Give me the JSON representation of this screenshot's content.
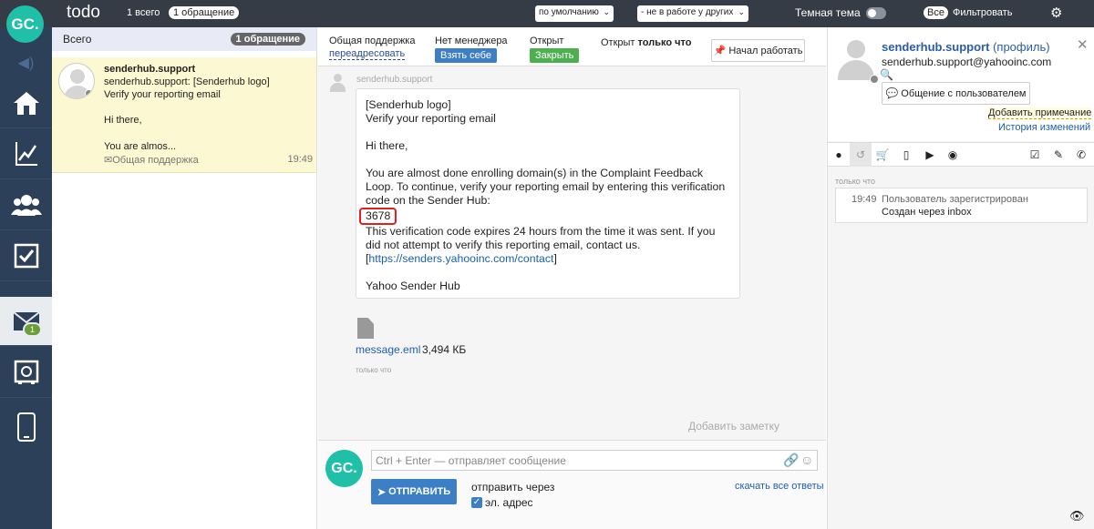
{
  "topbar": {
    "logo": "GC.",
    "title": "todo",
    "count_all": "1 всего",
    "count_one": "1 обращение",
    "sort_select": "по умолчанию",
    "filter_select": "- не в работе у других",
    "dark_theme": "Темная тема",
    "all_button": "Все",
    "filter_label": "Фильтровать"
  },
  "nav": {
    "mail_badge": "1"
  },
  "list": {
    "header": "Всего",
    "header_badge": "1 обращение",
    "items": [
      {
        "name": "senderhub.support",
        "subject": "senderhub.support: [Senderhub logo]",
        "line1": "Verify your reporting email",
        "line2": "Hi there,",
        "line3": "You are almos...",
        "queue": "Общая поддержка",
        "time": "19:49"
      }
    ]
  },
  "ticket_header": {
    "queue_label": "Общая поддержка",
    "reassign": "переадресовать",
    "no_manager": "Нет менеджера",
    "take_self": "Взять себе",
    "open_label": "Открыт",
    "close_btn": "Закрыть",
    "opened_prefix": "Открыт",
    "opened_when": "только что",
    "start_work": "Начал работать"
  },
  "message": {
    "sender": "senderhub.support",
    "line1": "[Senderhub logo]",
    "line2": "Verify your reporting email",
    "greeting": "Hi there,",
    "para1": "You are almost done enrolling domain(s) in the Complaint Feedback Loop. To continue, verify your reporting email by entering this verification code on the Sender Hub:",
    "code": "3678",
    "para2": "This verification code expires 24 hours from the time it was sent. If you did not attempt to verify this reporting email, contact us. [",
    "link": "https://senders.yahooinc.com/contact",
    "para2_end": "]",
    "signature": "Yahoo Sender Hub",
    "attachment_name": "message.eml",
    "attachment_size": "3,494 КБ",
    "time": "только что",
    "add_note": "Добавить заметку"
  },
  "composer": {
    "logo": "GC.",
    "placeholder": "Ctrl + Enter — отправляет сообщение",
    "send": "ОТПРАВИТЬ",
    "send_via": "отправить через",
    "email_option": "эл. адрес",
    "download_all": "скачать все ответы"
  },
  "profile": {
    "name": "senderhub.support",
    "profile_link": "(профиль)",
    "email": "senderhub.support@yahooinc.com",
    "chat_button": "Общение с пользователем",
    "add_remark": "Добавить примечание",
    "history": "История изменений",
    "timeline_label": "только что",
    "event_time": "19:49",
    "event_text": "Пользователь зарегистрирован",
    "event_sub": "Создан через inbox"
  }
}
